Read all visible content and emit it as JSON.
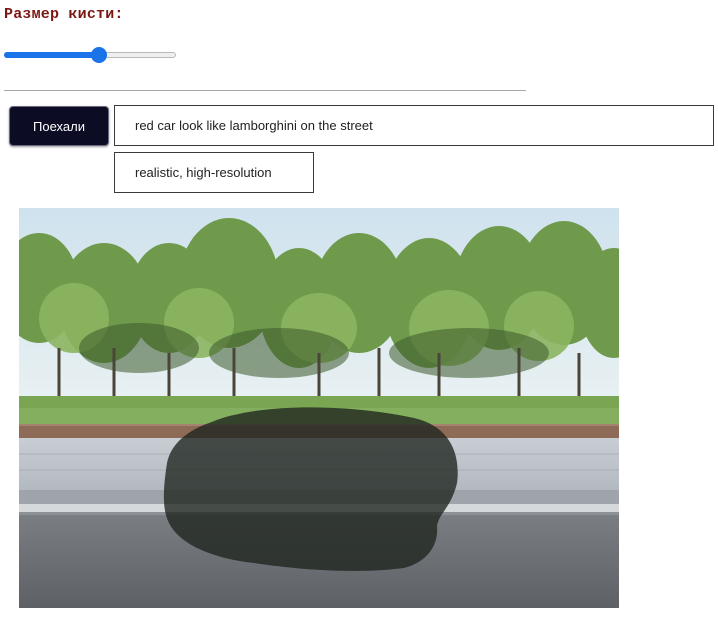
{
  "brush": {
    "label": "Размер кисти:",
    "value_fraction": 0.56,
    "accent_color": "#1a73e8"
  },
  "actions": {
    "go_label": "Поехали"
  },
  "prompts": {
    "main_text": "red car look like lamborghini on the street",
    "style_text": "realistic, high-resolution"
  },
  "canvas": {
    "scene": "street-with-park-photo",
    "mask_color": "#1e241e"
  }
}
